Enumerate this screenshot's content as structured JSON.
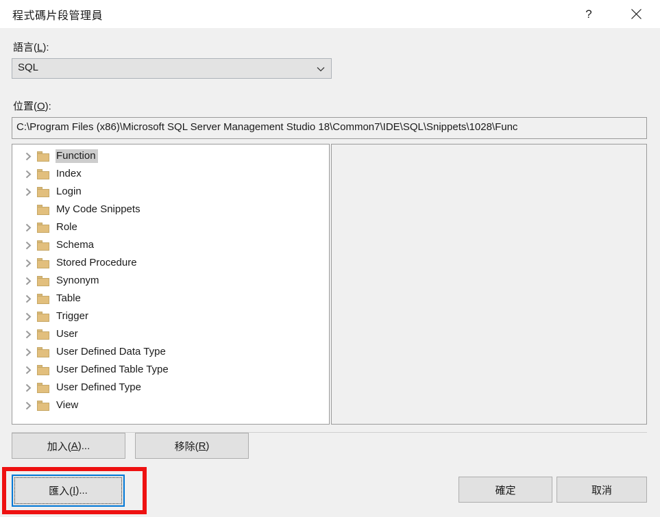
{
  "window": {
    "title": "程式碼片段管理員",
    "help_icon": "question-mark-icon",
    "close_icon": "close-icon"
  },
  "language_field": {
    "label_prefix": "語言(",
    "label_accel": "L",
    "label_suffix": "):",
    "value": "SQL",
    "arrow_icon": "chevron-down-icon"
  },
  "location_field": {
    "label_prefix": "位置(",
    "label_accel": "O",
    "label_suffix": "):",
    "value": "C:\\Program Files (x86)\\Microsoft SQL Server Management Studio 18\\Common7\\IDE\\SQL\\Snippets\\1028\\Func"
  },
  "tree": {
    "items": [
      {
        "label": "Function",
        "expandable": true,
        "selected": true
      },
      {
        "label": "Index",
        "expandable": true,
        "selected": false
      },
      {
        "label": "Login",
        "expandable": true,
        "selected": false
      },
      {
        "label": "My Code Snippets",
        "expandable": false,
        "selected": false
      },
      {
        "label": "Role",
        "expandable": true,
        "selected": false
      },
      {
        "label": "Schema",
        "expandable": true,
        "selected": false
      },
      {
        "label": "Stored Procedure",
        "expandable": true,
        "selected": false
      },
      {
        "label": "Synonym",
        "expandable": true,
        "selected": false
      },
      {
        "label": "Table",
        "expandable": true,
        "selected": false
      },
      {
        "label": "Trigger",
        "expandable": true,
        "selected": false
      },
      {
        "label": "User",
        "expandable": true,
        "selected": false
      },
      {
        "label": "User Defined Data Type",
        "expandable": true,
        "selected": false
      },
      {
        "label": "User Defined Table Type",
        "expandable": true,
        "selected": false
      },
      {
        "label": "User Defined Type",
        "expandable": true,
        "selected": false
      },
      {
        "label": "View",
        "expandable": true,
        "selected": false
      }
    ]
  },
  "buttons": {
    "add": {
      "prefix": "加入(",
      "accel": "A",
      "suffix": ")..."
    },
    "remove": {
      "prefix": "移除(",
      "accel": "R",
      "suffix": ")"
    },
    "import": {
      "prefix": "匯入(",
      "accel": "I",
      "suffix": ")..."
    },
    "ok": {
      "label": "確定"
    },
    "cancel": {
      "label": "取消"
    }
  },
  "annotation": {
    "color": "#ee1111",
    "target": "import-button"
  },
  "colors": {
    "dialog_background": "#f0f0f0",
    "titlebar_background": "#ffffff",
    "button_face": "#e1e1e1",
    "tree_background": "#ffffff",
    "selection": "#cdcdcd",
    "focus_border": "#0078d7",
    "folder_icon": "#e2bf7d"
  }
}
